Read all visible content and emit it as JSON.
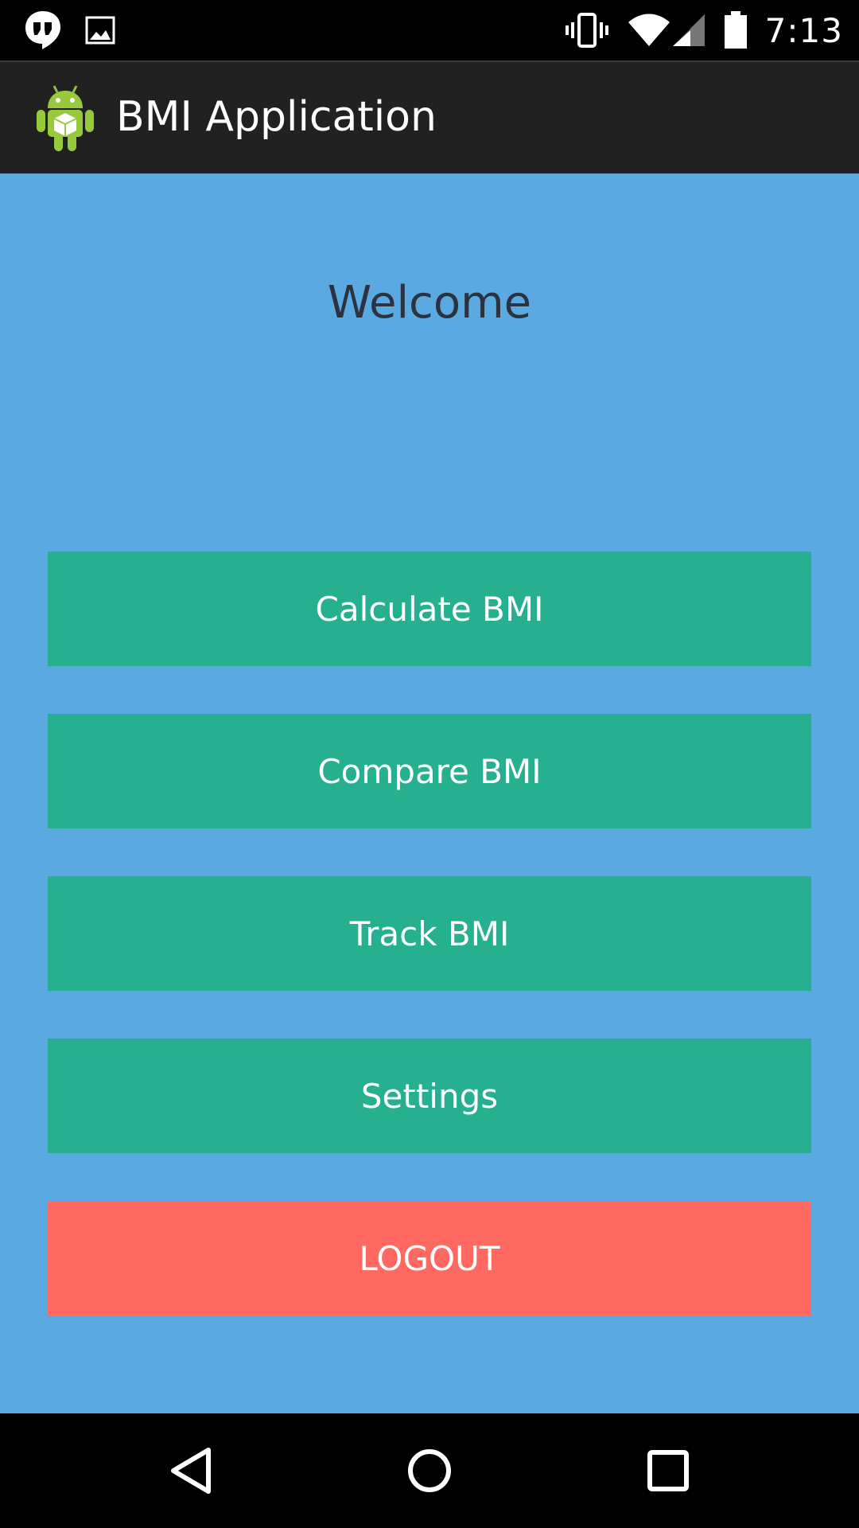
{
  "status_bar": {
    "time": "7:13",
    "icons": [
      "hangouts-icon",
      "image-icon",
      "vibrate-icon",
      "wifi-icon",
      "signal-icon",
      "battery-icon"
    ]
  },
  "action_bar": {
    "title": "BMI Application",
    "icon": "android-app-icon"
  },
  "main": {
    "welcome": "Welcome",
    "buttons": [
      {
        "label": "Calculate BMI",
        "color": "#26b08f"
      },
      {
        "label": "Compare BMI",
        "color": "#26b08f"
      },
      {
        "label": "Track BMI",
        "color": "#26b08f"
      },
      {
        "label": "Settings",
        "color": "#26b08f"
      }
    ],
    "logout_label": "LOGOUT",
    "logout_color": "#ff6962",
    "background_color": "#5aaae1"
  },
  "nav_bar": {
    "icons": [
      "back-icon",
      "home-icon",
      "recents-icon"
    ]
  }
}
